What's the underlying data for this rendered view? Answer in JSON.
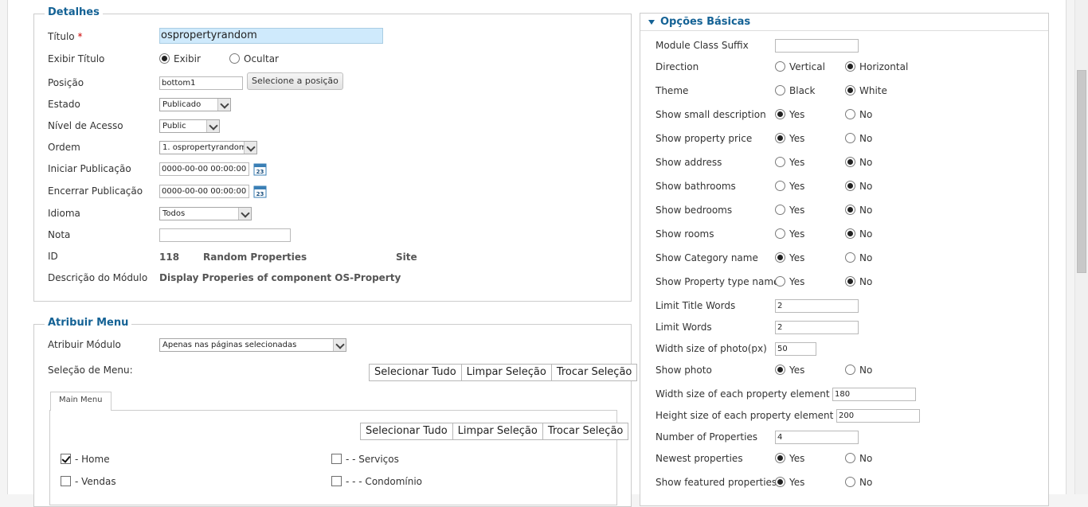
{
  "detalhes": {
    "legend": "Detalhes",
    "titulo_label": "Título",
    "required_mark": "*",
    "titulo_value": "ospropertyrandom",
    "exibir_titulo_label": "Exibir Título",
    "exibir": "Exibir",
    "ocultar": "Ocultar",
    "posicao_label": "Posição",
    "posicao_value": "bottom1",
    "selecione_posicao": "Selecione a posição",
    "estado_label": "Estado",
    "estado_value": "Publicado",
    "nivel_label": "Nível de Acesso",
    "nivel_value": "Public",
    "ordem_label": "Ordem",
    "ordem_value": "1. ospropertyrandom",
    "iniciar_label": "Iniciar Publicação",
    "iniciar_value": "0000-00-00 00:00:00",
    "encerrar_label": "Encerrar Publicação",
    "encerrar_value": "0000-00-00 00:00:00",
    "calendar_day": "23",
    "idioma_label": "Idioma",
    "idioma_value": "Todos",
    "nota_label": "Nota",
    "nota_value": "",
    "id_label": "ID",
    "id_value": "118",
    "module_name": "Random Properties",
    "site": "Site",
    "descricao_label": "Descrição do Módulo",
    "descricao_value": "Display Properies of component OS-Property"
  },
  "atribuir": {
    "legend": "Atribuir Menu",
    "modulo_label": "Atribuir Módulo",
    "modulo_value": "Apenas nas páginas selecionadas",
    "selecao_label": "Seleção de Menu:",
    "selecionar_tudo": "Selecionar Tudo",
    "limpar_selecao": "Limpar Seleção",
    "trocar_selecao": "Trocar Seleção",
    "tab_main_menu": "Main Menu",
    "items": [
      {
        "label": "- Home",
        "checked": true
      },
      {
        "label": "- - Serviços",
        "checked": false
      },
      {
        "label": "- Vendas",
        "checked": false
      },
      {
        "label": "- - - Condomínio",
        "checked": false
      }
    ]
  },
  "opcoes": {
    "header": "Opções Básicas",
    "yes": "Yes",
    "no": "No",
    "module_class_suffix": "Module Class Suffix",
    "module_class_suffix_value": "",
    "direction": "Direction",
    "vertical": "Vertical",
    "horizontal": "Horizontal",
    "theme": "Theme",
    "black": "Black",
    "white": "White",
    "show_small_description": "Show small description",
    "show_property_price": "Show property price",
    "show_address": "Show address",
    "show_bathrooms": "Show bathrooms",
    "show_bedrooms": "Show bedrooms",
    "show_rooms": "Show rooms",
    "show_category_name": "Show Category name",
    "show_property_type_name": "Show Property type name",
    "limit_title_words": "Limit Title Words",
    "limit_title_words_value": "2",
    "limit_words": "Limit Words",
    "limit_words_value": "2",
    "width_photo": "Width size of photo(px)",
    "width_photo_value": "50",
    "show_photo": "Show photo",
    "width_element": "Width size of each property element (px)",
    "width_element_value": "180",
    "height_element": "Height size of each property element (px)",
    "height_element_value": "200",
    "number_properties": "Number of Properties",
    "number_properties_value": "4",
    "newest_properties": "Newest properties",
    "show_featured": "Show featured properties"
  }
}
